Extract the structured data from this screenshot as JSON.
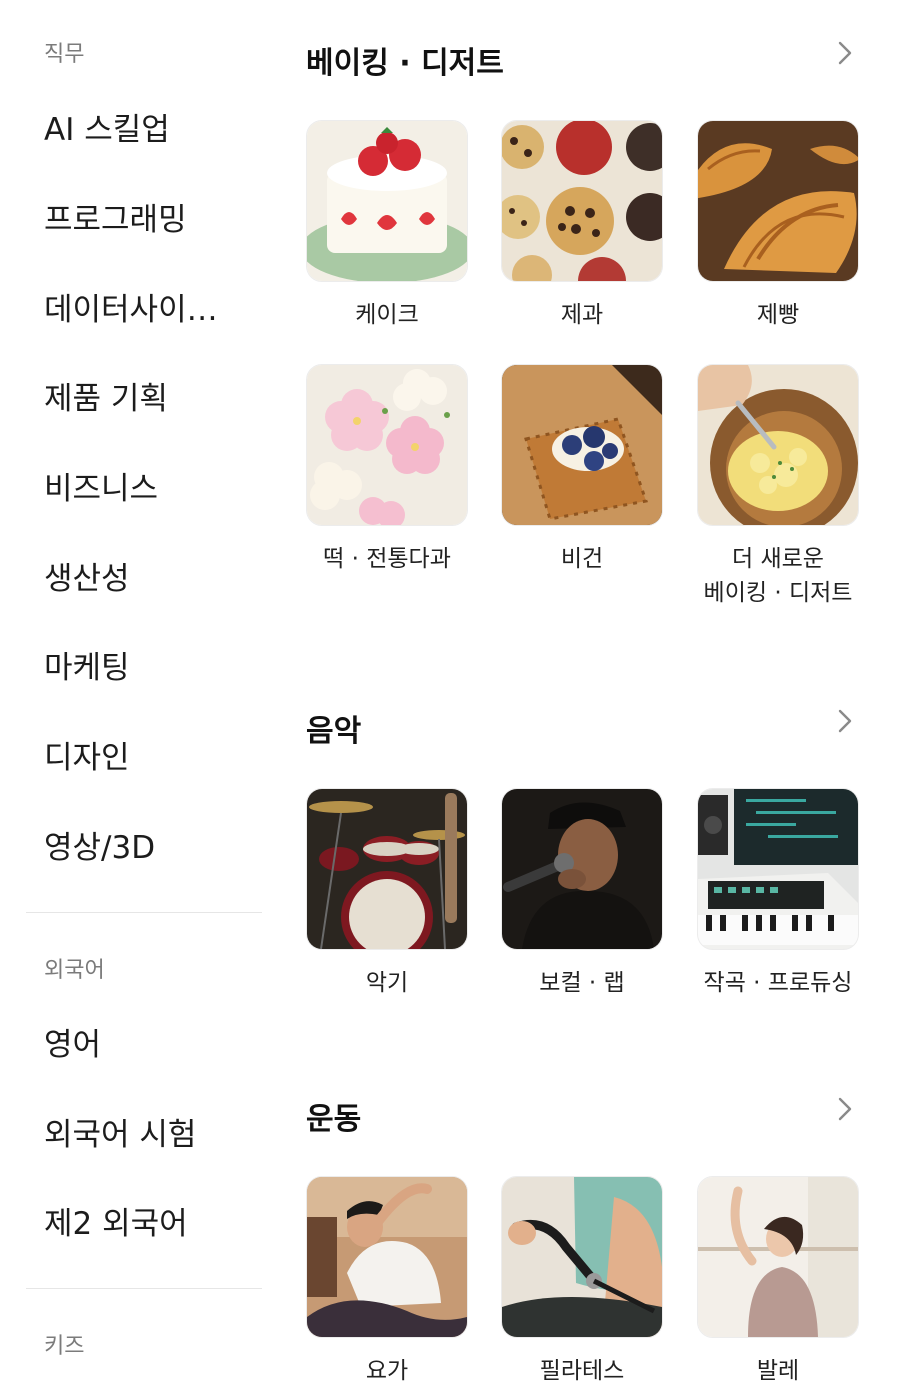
{
  "sidebar": {
    "job": {
      "heading": "직무",
      "items": [
        "AI 스킬업",
        "프로그래밍",
        "데이터사이…",
        "제품 기획",
        "비즈니스",
        "생산성",
        "마케팅",
        "디자인",
        "영상/3D"
      ]
    },
    "language": {
      "heading": "외국어",
      "items": [
        "영어",
        "외국어 시험",
        "제2 외국어"
      ]
    },
    "kids": {
      "heading": "키즈"
    }
  },
  "sections": [
    {
      "title": "베이킹 · 디저트",
      "chevron_icon": "chevron-right-icon",
      "tiles": [
        {
          "label": "케이크",
          "icon": "strawberry-cake-photo"
        },
        {
          "label": "제과",
          "icon": "cookies-photo"
        },
        {
          "label": "제빵",
          "icon": "croissant-photo"
        },
        {
          "label": "떡 · 전통다과",
          "icon": "rice-cake-flowers-photo"
        },
        {
          "label": "비건",
          "icon": "blueberry-granola-photo"
        },
        {
          "label": "더 새로운\n베이킹 · 디저트",
          "icon": "mixing-bowl-photo"
        }
      ]
    },
    {
      "title": "음악",
      "chevron_icon": "chevron-right-icon",
      "tiles": [
        {
          "label": "악기",
          "icon": "drum-kit-photo"
        },
        {
          "label": "보컬 · 랩",
          "icon": "singer-mic-photo"
        },
        {
          "label": "작곡 · 프로듀싱",
          "icon": "studio-keyboard-photo"
        }
      ]
    },
    {
      "title": "운동",
      "chevron_icon": "chevron-right-icon",
      "tiles": [
        {
          "label": "요가",
          "icon": "yoga-pose-photo"
        },
        {
          "label": "필라테스",
          "icon": "pilates-band-photo"
        },
        {
          "label": "발레",
          "icon": "ballet-pose-photo"
        }
      ]
    }
  ]
}
